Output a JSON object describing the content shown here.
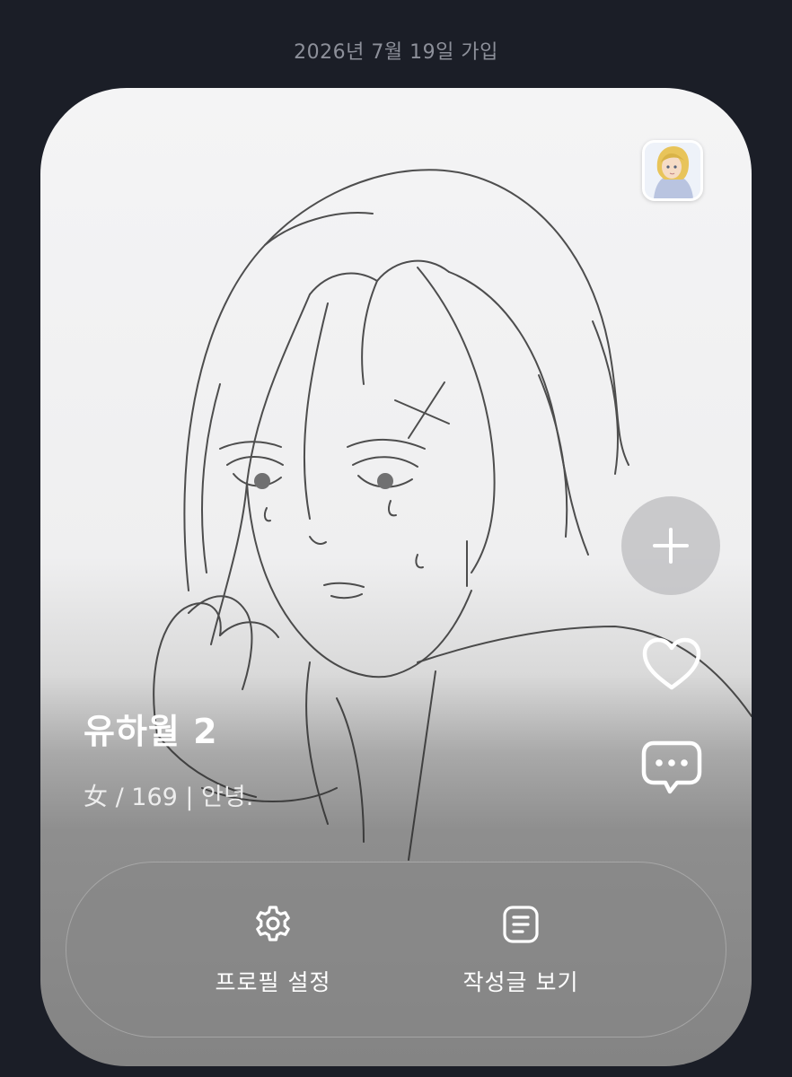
{
  "header": {
    "join_date": "2026년 7월 19일 가입"
  },
  "profile": {
    "name": "유하월 2",
    "info": "女 / 169 | 안녕."
  },
  "side_actions": {
    "add_icon": "plus-icon",
    "like_icon": "heart-icon",
    "message_icon": "chat-bubble-icon"
  },
  "actions": [
    {
      "label": "프로필 설정",
      "icon": "gear-icon"
    },
    {
      "label": "작성글 보기",
      "icon": "document-list-icon"
    }
  ],
  "colors": {
    "background": "#1b1e27",
    "card_top": "#f4f4f5",
    "card_bottom": "#848484",
    "text_primary": "#ffffff",
    "text_muted": "#8d909a"
  }
}
